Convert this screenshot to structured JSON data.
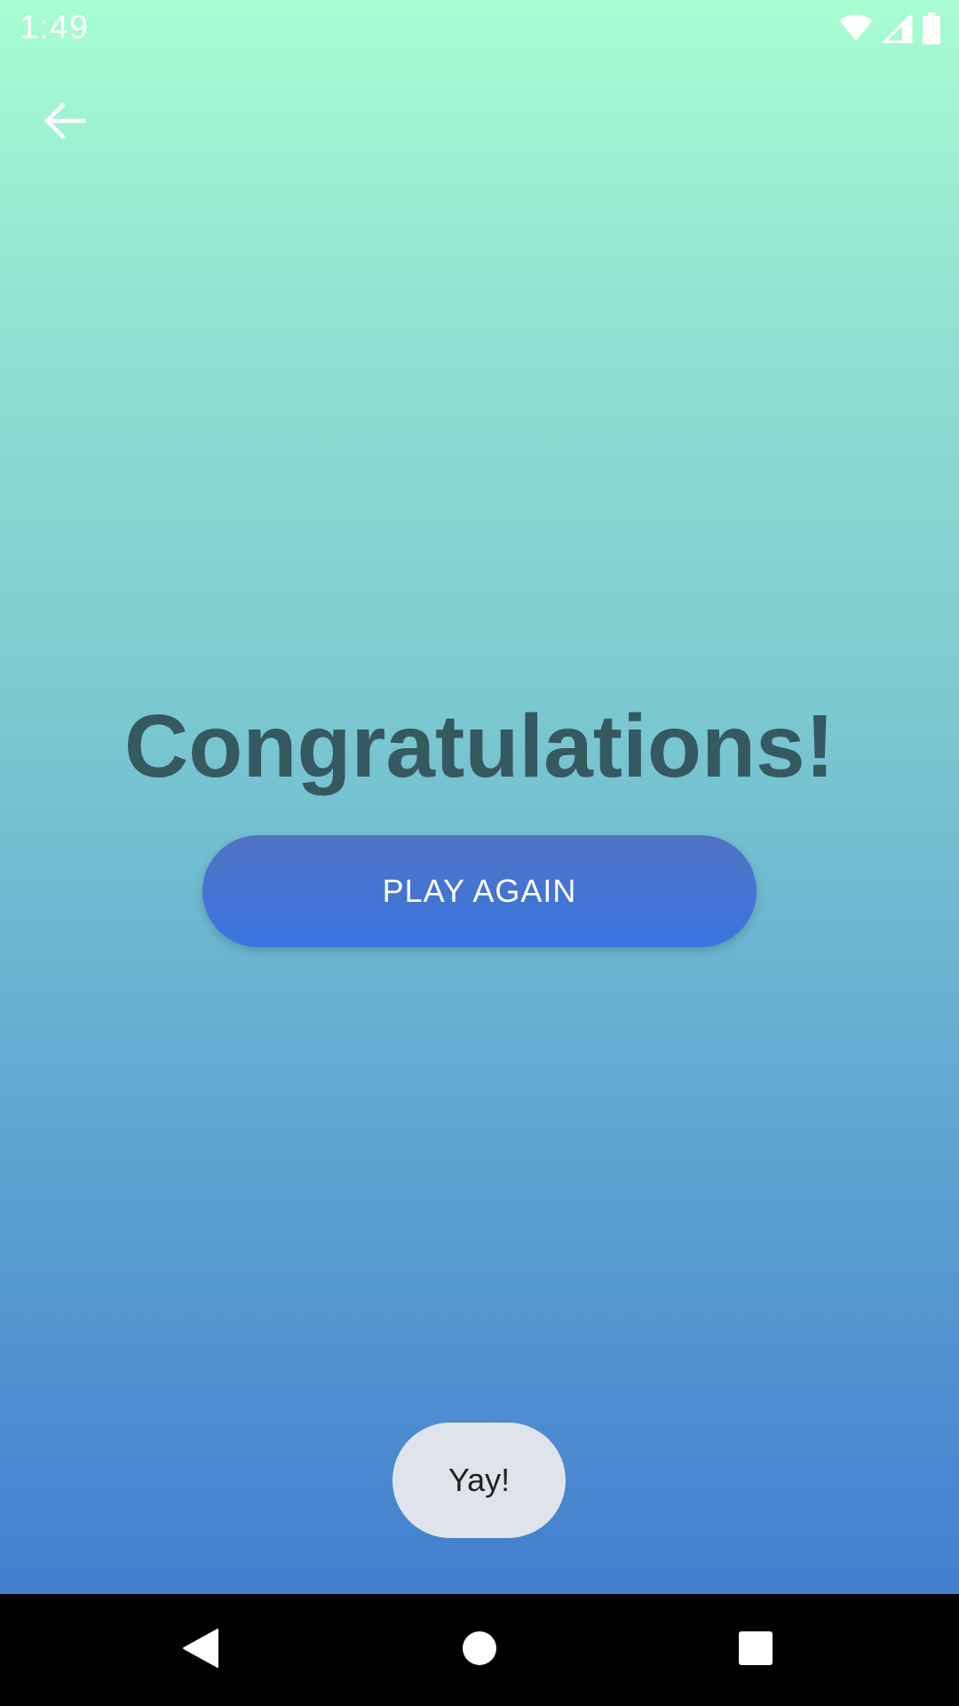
{
  "status_bar": {
    "time": "1:49",
    "icons": [
      "wifi-icon",
      "signal-icon",
      "battery-icon"
    ]
  },
  "header": {
    "back_icon": "arrow-left-icon"
  },
  "main": {
    "title": "Congratulations!",
    "play_again_label": "PLAY AGAIN"
  },
  "toast": {
    "text": "Yay!"
  },
  "nav_bar": {
    "buttons": [
      "back-triangle-icon",
      "home-circle-icon",
      "recents-square-icon"
    ]
  },
  "colors": {
    "title": "#36585f",
    "button": "#3f74d6",
    "toast_bg": "#dfe4ec",
    "gradient_top": "#a8fdd2",
    "gradient_bottom": "#3a76cc"
  }
}
